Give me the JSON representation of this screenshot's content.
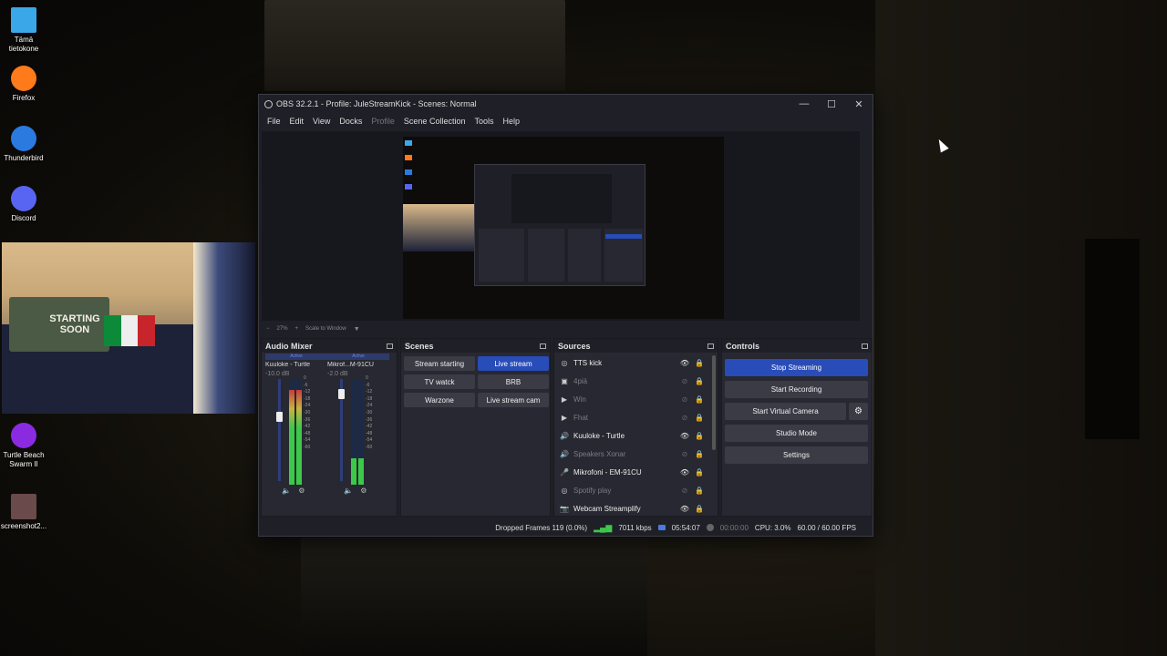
{
  "desktop": {
    "icons": [
      {
        "name": "computer-icon",
        "label": "Tämä\ntietokone",
        "color": "#3aa7e8"
      },
      {
        "name": "firefox-icon",
        "label": "Firefox",
        "color": "#ff7a1a"
      },
      {
        "name": "thunderbird-icon",
        "label": "Thunderbird",
        "color": "#2b7ae0"
      },
      {
        "name": "discord-icon",
        "label": "Discord",
        "color": "#5865f2"
      },
      {
        "name": "turtle-beach-icon",
        "label": "Turtle Beach\nSwarm II",
        "color": "#8a2be2"
      },
      {
        "name": "screenshot-file-icon",
        "label": "screenshot2...",
        "color": "#6a4a4a"
      }
    ],
    "webcam_poster_text": "STARTING SOON"
  },
  "window": {
    "title": "OBS 32.2.1 - Profile: JuleStreamKick - Scenes: Normal",
    "controls": {
      "minimize": "—",
      "maximize": "☐",
      "close": "✕"
    }
  },
  "menu": [
    "File",
    "Edit",
    "View",
    "Docks",
    "Profile",
    "Scene Collection",
    "Tools",
    "Help"
  ],
  "menu_disabled": [
    "Profile"
  ],
  "preview": {
    "zoom": "27%",
    "scale_mode": "Scale to Window"
  },
  "audio_mixer": {
    "title": "Audio Mixer",
    "channels": [
      {
        "status": "Active",
        "name": "Kuuloke - Turtle",
        "db": "-10.0 dB",
        "level": 0.9,
        "volume": 0.68
      },
      {
        "status": "Active",
        "name": "Mikrof...M-91CU",
        "db": "-2.0 dB",
        "level": 0.25,
        "volume": 0.9
      }
    ],
    "ticks": [
      "0",
      "-6",
      "-12",
      "-18",
      "-24",
      "-30",
      "-36",
      "-42",
      "-48",
      "-54",
      "-60"
    ]
  },
  "scenes": {
    "title": "Scenes",
    "items": [
      "Stream starting",
      "Live stream",
      "TV watck",
      "BRB",
      "Warzone",
      "Live stream cam"
    ],
    "active": "Live stream"
  },
  "sources": {
    "title": "Sources",
    "items": [
      {
        "name": "TTS kick",
        "icon": "◎",
        "visible": true
      },
      {
        "name": "4piä",
        "icon": "▣",
        "visible": false
      },
      {
        "name": "Win",
        "icon": "▶",
        "visible": false
      },
      {
        "name": "Fhat",
        "icon": "▶",
        "visible": false
      },
      {
        "name": "Kuuloke - Turtle",
        "icon": "🔊",
        "visible": true
      },
      {
        "name": "Speakers Xonar",
        "icon": "🔊",
        "visible": false
      },
      {
        "name": "Mikrofoni - EM-91CU",
        "icon": "🎤",
        "visible": true
      },
      {
        "name": "Spotify play",
        "icon": "◎",
        "visible": false
      },
      {
        "name": "Webcam Streamplify",
        "icon": "📷",
        "visible": true
      }
    ]
  },
  "controls": {
    "title": "Controls",
    "stop_streaming": "Stop Streaming",
    "start_recording": "Start Recording",
    "start_virtual_camera": "Start Virtual Camera",
    "studio_mode": "Studio Mode",
    "settings": "Settings"
  },
  "status": {
    "dropped_frames": "Dropped Frames 119 (0.0%)",
    "bitrate": "7011 kbps",
    "stream_time": "05:54:07",
    "record_time": "00:00:00",
    "cpu": "CPU: 3.0%",
    "fps": "60.00 / 60.00 FPS"
  },
  "colors": {
    "accent": "#284cb8",
    "meter_green": "#3cc84a",
    "meter_yellow": "#c8b43c",
    "meter_red": "#c83c3c"
  }
}
